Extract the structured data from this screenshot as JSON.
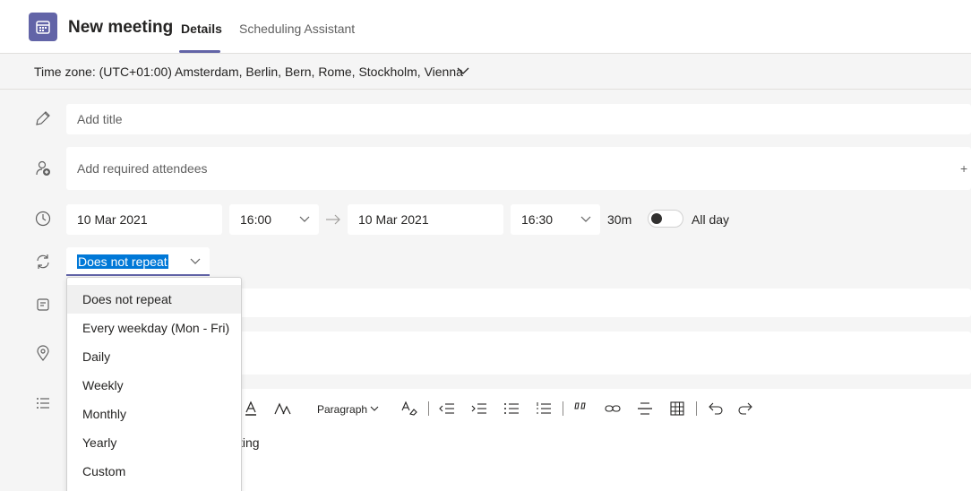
{
  "header": {
    "title": "New meeting",
    "tabs": [
      {
        "label": "Details",
        "active": true
      },
      {
        "label": "Scheduling Assistant",
        "active": false
      }
    ],
    "accent_color": "#6264a7"
  },
  "timezone": {
    "label": "Time zone: (UTC+01:00) Amsterdam, Berlin, Bern, Rome, Stockholm, Vienna"
  },
  "form": {
    "title_placeholder": "Add title",
    "attendees_placeholder": "Add required attendees",
    "add_optional": "+",
    "start_date": "10 Mar 2021",
    "start_time": "16:00",
    "end_date": "10 Mar 2021",
    "end_time": "16:30",
    "duration": "30m",
    "all_day_label": "All day",
    "repeat_selected": "Does not repeat"
  },
  "repeat_options": [
    "Does not repeat",
    "Every weekday (Mon - Fri)",
    "Daily",
    "Weekly",
    "Monthly",
    "Yearly",
    "Custom"
  ],
  "editor": {
    "paragraph_label": "Paragraph",
    "partial_text": "ting"
  },
  "icons": [
    "calendar-icon",
    "pencil-icon",
    "add-person-icon",
    "clock-icon",
    "repeat-icon",
    "channel-icon",
    "location-icon",
    "details-list-icon",
    "chevron-down-icon",
    "arrow-right-icon"
  ]
}
